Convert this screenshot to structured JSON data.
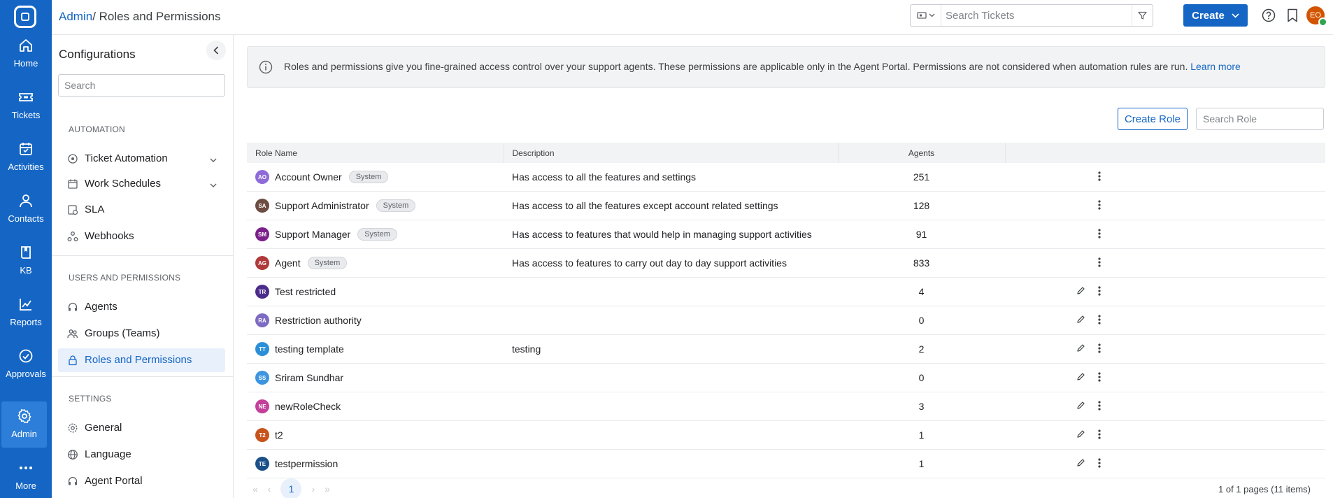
{
  "rail": {
    "items": [
      {
        "label": "Home",
        "icon": "home-icon"
      },
      {
        "label": "Tickets",
        "icon": "ticket-icon"
      },
      {
        "label": "Activities",
        "icon": "calendar-icon"
      },
      {
        "label": "Contacts",
        "icon": "contacts-icon"
      },
      {
        "label": "KB",
        "icon": "book-icon"
      },
      {
        "label": "Reports",
        "icon": "chart-icon"
      },
      {
        "label": "Approvals",
        "icon": "check-circle-icon"
      },
      {
        "label": "Admin",
        "icon": "gear-icon"
      },
      {
        "label": "More",
        "icon": "more-icon"
      }
    ],
    "active": "Admin",
    "bg_color": "#1566c4"
  },
  "header": {
    "breadcrumb_root": "Admin",
    "breadcrumb_sep": "/",
    "breadcrumb_current": " Roles and Permissions",
    "search_placeholder": "Search Tickets",
    "create_label": "Create",
    "user_initials": "EO"
  },
  "config": {
    "title": "Configurations",
    "search_placeholder": "Search",
    "sections": [
      {
        "title": "AUTOMATION",
        "items": [
          {
            "label": "Ticket Automation",
            "expandable": true,
            "icon": "automation-icon"
          },
          {
            "label": "Work Schedules",
            "expandable": true,
            "icon": "schedule-icon"
          },
          {
            "label": "SLA",
            "expandable": false,
            "icon": "sla-icon"
          },
          {
            "label": "Webhooks",
            "expandable": false,
            "icon": "webhook-icon"
          }
        ]
      },
      {
        "title": "USERS AND PERMISSIONS",
        "items": [
          {
            "label": "Agents",
            "icon": "headset-icon"
          },
          {
            "label": "Groups (Teams)",
            "icon": "groups-icon"
          },
          {
            "label": "Roles and Permissions",
            "icon": "lock-icon",
            "active": true
          }
        ]
      },
      {
        "title": "SETTINGS",
        "items": [
          {
            "label": "General",
            "icon": "gear-icon"
          },
          {
            "label": "Language",
            "icon": "globe-icon"
          },
          {
            "label": "Agent Portal",
            "icon": "headset-icon"
          }
        ]
      }
    ]
  },
  "banner": {
    "text": "Roles and permissions give you fine-grained access control over your support agents. These permissions are applicable only in the Agent Portal. Permissions are not considered when automation rules are run. ",
    "link": "Learn more"
  },
  "toolbar": {
    "create_role_label": "Create Role",
    "search_role_placeholder": "Search Role"
  },
  "table": {
    "columns": [
      "Role Name",
      "Description",
      "Agents",
      ""
    ],
    "rows": [
      {
        "initials": "AO",
        "color": "#8e6bd8",
        "name": "Account Owner",
        "badge": "System",
        "description": "Has access to all the features and settings",
        "agents": "251",
        "editable": false
      },
      {
        "initials": "SA",
        "color": "#6d4c41",
        "name": "Support Administrator",
        "badge": "System",
        "description": "Has access to all the features except account related settings",
        "agents": "128",
        "editable": false
      },
      {
        "initials": "SM",
        "color": "#7b1f8a",
        "name": "Support Manager",
        "badge": "System",
        "description": "Has access to features that would help in managing support activities",
        "agents": "91",
        "editable": false
      },
      {
        "initials": "AG",
        "color": "#b03a3a",
        "name": "Agent",
        "badge": "System",
        "description": "Has access to features to carry out day to day support activities",
        "agents": "833",
        "editable": false
      },
      {
        "initials": "TR",
        "color": "#4b2c8a",
        "name": "Test restricted",
        "badge": "",
        "description": "",
        "agents": "4",
        "editable": true
      },
      {
        "initials": "RA",
        "color": "#7e6bc4",
        "name": "Restriction authority",
        "badge": "",
        "description": "",
        "agents": "0",
        "editable": true
      },
      {
        "initials": "TT",
        "color": "#2b8fd8",
        "name": "testing template",
        "badge": "",
        "description": "testing",
        "agents": "2",
        "editable": true
      },
      {
        "initials": "SS",
        "color": "#3d95e0",
        "name": "Sriram Sundhar",
        "badge": "",
        "description": "",
        "agents": "0",
        "editable": true
      },
      {
        "initials": "NE",
        "color": "#c2409a",
        "name": "newRoleCheck",
        "badge": "",
        "description": "",
        "agents": "3",
        "editable": true
      },
      {
        "initials": "T2",
        "color": "#c8531c",
        "name": "t2",
        "badge": "",
        "description": "",
        "agents": "1",
        "editable": true
      },
      {
        "initials": "TE",
        "color": "#1a4f8a",
        "name": "testpermission",
        "badge": "",
        "description": "",
        "agents": "1",
        "editable": true
      }
    ]
  },
  "pagination": {
    "current_page": "1",
    "info": "1 of 1 pages (11 items)"
  }
}
